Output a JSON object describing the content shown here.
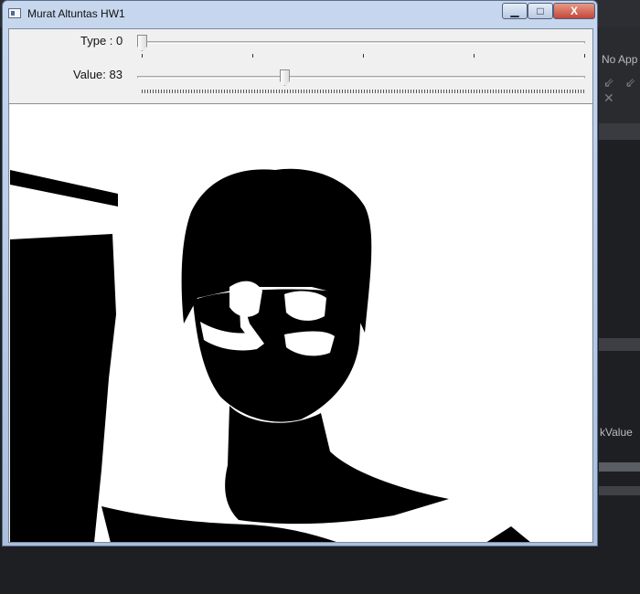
{
  "window": {
    "title": "Murat Altuntas HW1",
    "controls": {
      "minimize": "▁",
      "maximize": "□",
      "close": "X"
    }
  },
  "trackbars": {
    "type": {
      "label": "Type : 0",
      "value": 0,
      "min": 0,
      "max": 4
    },
    "value": {
      "label": "Value: 83",
      "value": 83,
      "min": 0,
      "max": 255
    }
  },
  "background": {
    "text_top": "No App",
    "text_code": "kValue",
    "icons": "⇙ ⇙ ✕"
  },
  "colors": {
    "frame": "#b4c8e4",
    "close": "#c4473a",
    "image_fg": "#000000",
    "image_bg": "#ffffff"
  }
}
